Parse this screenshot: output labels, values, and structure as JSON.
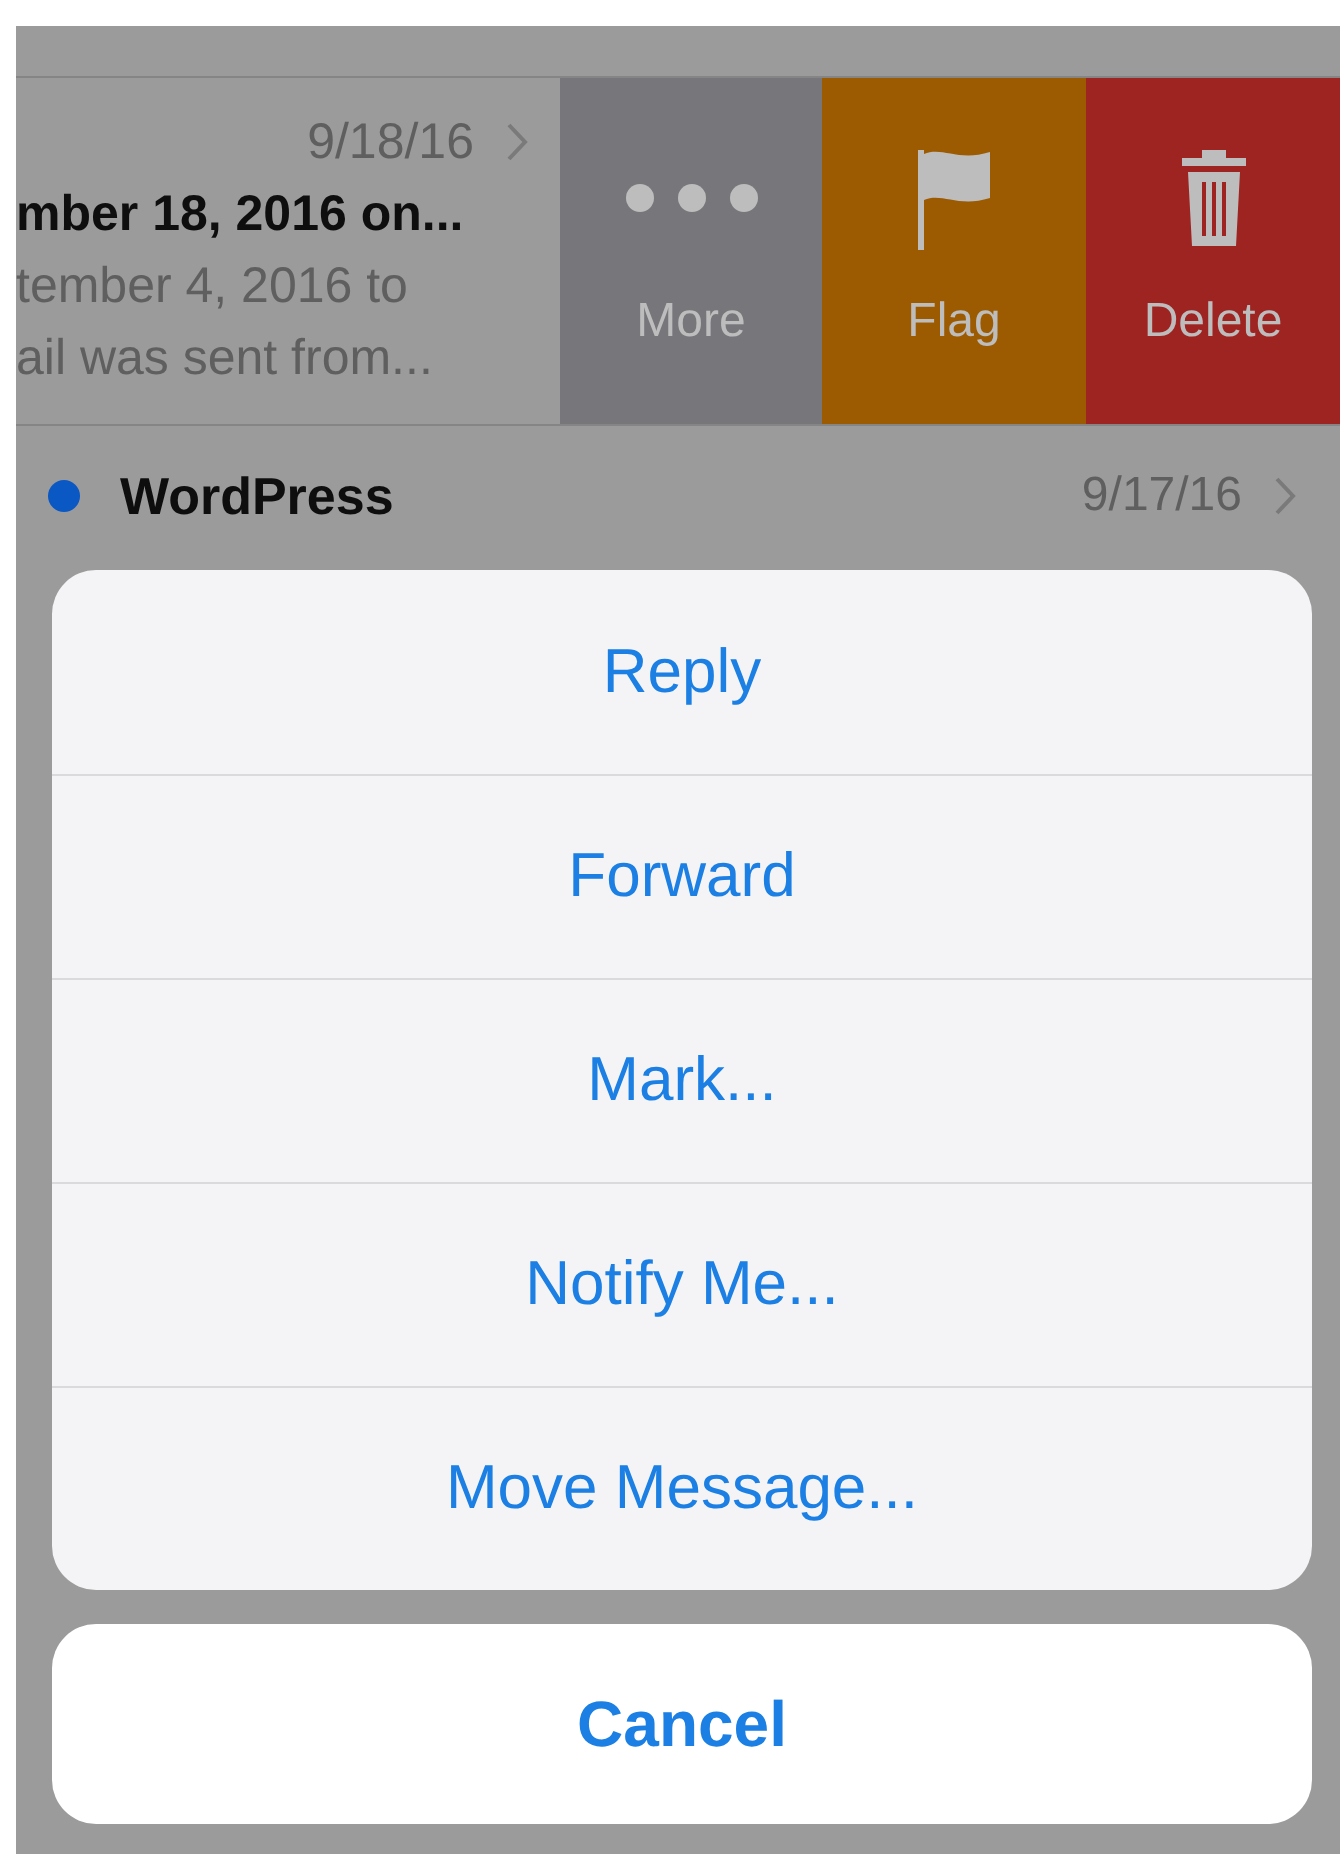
{
  "messages": [
    {
      "kind": "swiped",
      "date": "9/18/16",
      "subject": "mber 18, 2016 on...",
      "preview_lines": [
        "tember 4, 2016 to",
        "ail was sent from..."
      ],
      "actions": [
        {
          "kind": "more",
          "label": "More",
          "color": "#77767b"
        },
        {
          "kind": "flag",
          "label": "Flag",
          "color": "#9c5b00"
        },
        {
          "kind": "delete",
          "label": "Delete",
          "color": "#9e2422"
        }
      ]
    },
    {
      "kind": "full",
      "unread": true,
      "sender": "WordPress",
      "date": "9/17/16"
    }
  ],
  "action_sheet": {
    "items": [
      "Reply",
      "Forward",
      "Mark...",
      "Notify Me...",
      "Move Message..."
    ],
    "cancel": "Cancel"
  }
}
